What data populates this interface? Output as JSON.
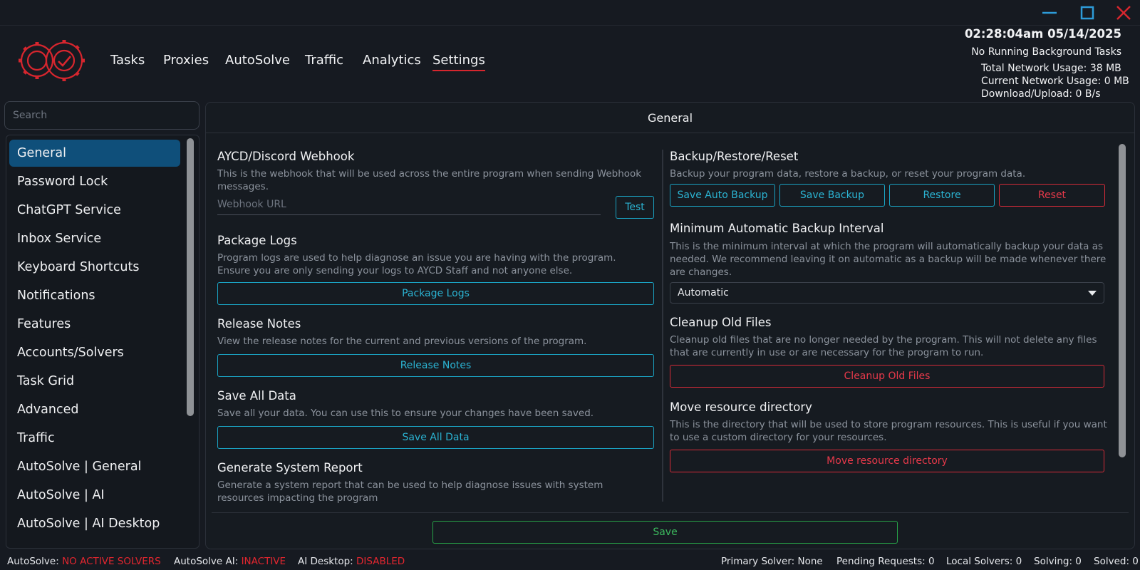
{
  "nav": {
    "items": [
      {
        "label": "Tasks"
      },
      {
        "label": "Proxies"
      },
      {
        "label": "AutoSolve"
      },
      {
        "label": "Traffic"
      },
      {
        "label": "Analytics"
      },
      {
        "label": "Settings",
        "active": true
      }
    ]
  },
  "header": {
    "datetime": "02:28:04am 05/14/2025",
    "background_tasks": "No Running Background Tasks",
    "total_network": "Total Network Usage:  38 MB",
    "current_network": "Current Network Usage: 0 MB",
    "download_upload": "Download/Upload: 0 B/s"
  },
  "sidebar": {
    "search_placeholder": "Search",
    "items": [
      {
        "label": "General",
        "active": true
      },
      {
        "label": "Password Lock"
      },
      {
        "label": "ChatGPT Service"
      },
      {
        "label": "Inbox Service"
      },
      {
        "label": "Keyboard Shortcuts"
      },
      {
        "label": "Notifications"
      },
      {
        "label": "Features"
      },
      {
        "label": "Accounts/Solvers"
      },
      {
        "label": "Task Grid"
      },
      {
        "label": "Advanced"
      },
      {
        "label": "Traffic"
      },
      {
        "label": "AutoSolve | General"
      },
      {
        "label": "AutoSolve | AI"
      },
      {
        "label": "AutoSolve | AI Desktop"
      }
    ]
  },
  "main": {
    "title": "General",
    "webhook": {
      "title": "AYCD/Discord Webhook",
      "desc": "This is the webhook that will be used across the entire program when sending Webhook messages.",
      "placeholder": "Webhook URL",
      "test_label": "Test"
    },
    "package_logs": {
      "title": "Package Logs",
      "desc": "Program logs are used to help diagnose an issue you are having with the program. Ensure you are only sending your logs to AYCD Staff and not anyone else.",
      "button": "Package Logs"
    },
    "release_notes": {
      "title": "Release Notes",
      "desc": "View the release notes for the current and previous versions of the program.",
      "button": "Release Notes"
    },
    "save_all": {
      "title": "Save All Data",
      "desc": "Save all your data. You can use this to ensure your changes have been saved.",
      "button": "Save All Data"
    },
    "system_report": {
      "title": "Generate System Report",
      "desc": "Generate a system report that can be used to help diagnose issues with system resources impacting the program"
    },
    "backup": {
      "title": "Backup/Restore/Reset",
      "desc": "Backup your program data, restore a backup, or reset your program data.",
      "save_auto": "Save Auto Backup",
      "save_backup": "Save Backup",
      "restore": "Restore",
      "reset": "Reset"
    },
    "backup_interval": {
      "title": "Minimum Automatic Backup Interval",
      "desc": "This is the minimum interval at which the program will automatically backup your data as needed. We recommend leaving it on automatic as a backup will be made whenever there are changes.",
      "selected": "Automatic"
    },
    "cleanup": {
      "title": "Cleanup Old Files",
      "desc": "Cleanup old files that are no longer needed by the program. This will not delete any files that are currently in use or are necessary for the program to run.",
      "button": "Cleanup Old Files"
    },
    "resource_dir": {
      "title": "Move resource directory",
      "desc": "This is the directory that will be used to store program resources. This is useful if you want to use a custom directory for your resources.",
      "button": "Move resource directory"
    },
    "save_label": "Save"
  },
  "status_bar": {
    "autosolve_label": "AutoSolve:",
    "autosolve_value": "NO ACTIVE SOLVERS",
    "autosolve_ai_label": "AutoSolve AI:",
    "autosolve_ai_value": "INACTIVE",
    "ai_desktop_label": "AI Desktop:",
    "ai_desktop_value": "DISABLED",
    "primary_solver": "Primary Solver: None",
    "pending_requests": "Pending Requests: 0",
    "local_solvers": "Local Solvers: 0",
    "solving": "Solving: 0",
    "solved": "Solved: 0"
  },
  "colors": {
    "accent_red": "#d6262e",
    "accent_blue": "#1aa3c3",
    "accent_green": "#27a348",
    "active_item": "#0f4f7a"
  }
}
